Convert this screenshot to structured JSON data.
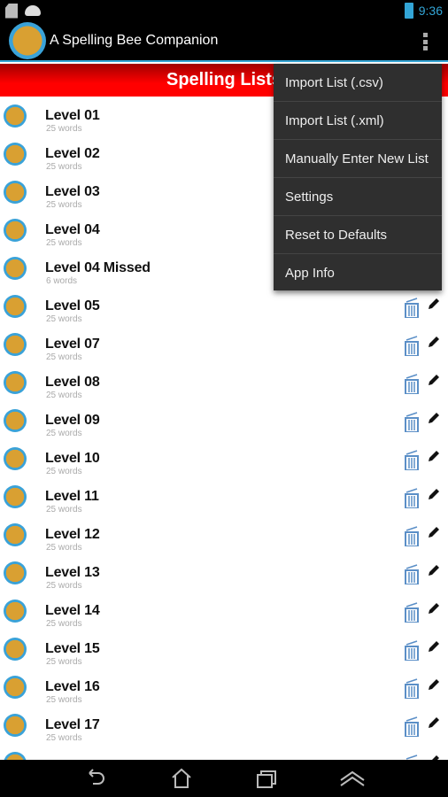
{
  "status_bar": {
    "time": "9:36",
    "icons": [
      "sd-card-icon",
      "android-icon",
      "battery-icon"
    ]
  },
  "action_bar": {
    "title": "A Spelling Bee Companion",
    "overflow_icon": "more-vert-icon"
  },
  "header": {
    "title": "Spelling Lists"
  },
  "colors": {
    "accent": "#33a5d6",
    "header_red": "#ff0000",
    "menu_bg": "#2f2f2f",
    "trash_blue": "#5b8fc7"
  },
  "lists": [
    {
      "name": "Level 01",
      "count": "25 words"
    },
    {
      "name": "Level 02",
      "count": "25 words"
    },
    {
      "name": "Level 03",
      "count": "25 words"
    },
    {
      "name": "Level 04",
      "count": "25 words"
    },
    {
      "name": "Level 04 Missed",
      "count": "6 words"
    },
    {
      "name": "Level 05",
      "count": "25 words"
    },
    {
      "name": "Level 07",
      "count": "25 words"
    },
    {
      "name": "Level 08",
      "count": "25 words"
    },
    {
      "name": "Level 09",
      "count": "25 words"
    },
    {
      "name": "Level 10",
      "count": "25 words"
    },
    {
      "name": "Level 11",
      "count": "25 words"
    },
    {
      "name": "Level 12",
      "count": "25 words"
    },
    {
      "name": "Level 13",
      "count": "25 words"
    },
    {
      "name": "Level 14",
      "count": "25 words"
    },
    {
      "name": "Level 15",
      "count": "25 words"
    },
    {
      "name": "Level 16",
      "count": "25 words"
    },
    {
      "name": "Level 17",
      "count": "25 words"
    },
    {
      "name": "",
      "count": ""
    }
  ],
  "menu": {
    "items": [
      "Import List (.csv)",
      "Import List (.xml)",
      "Manually Enter New List",
      "Settings",
      "Reset to Defaults",
      "App Info"
    ]
  },
  "nav_bar": {
    "icons": [
      "back-icon",
      "home-icon",
      "recent-apps-icon",
      "menu-up-icon"
    ]
  }
}
